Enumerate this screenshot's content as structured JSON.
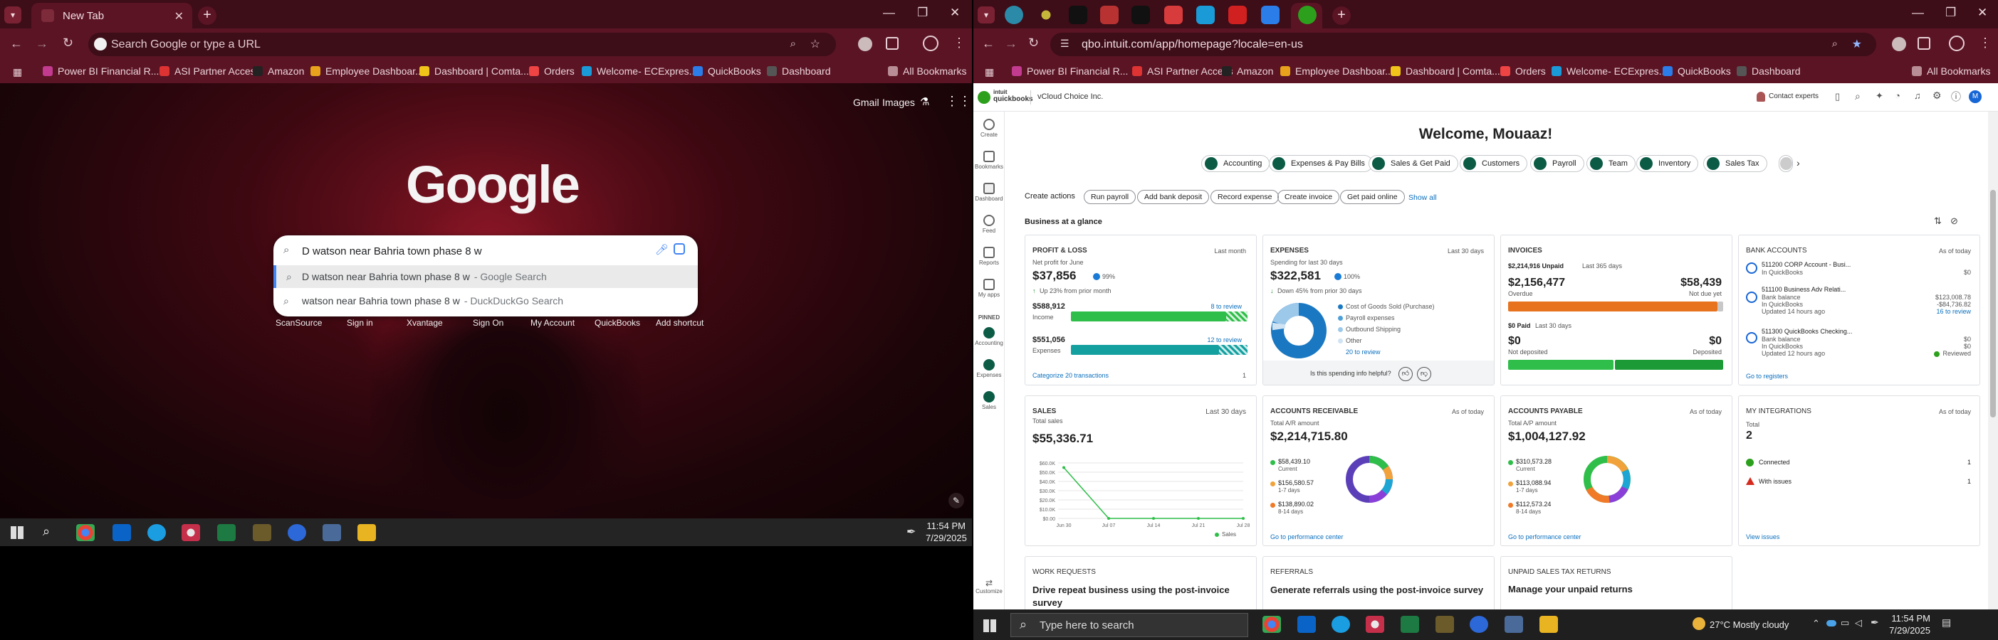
{
  "left": {
    "tab_title": "New Tab",
    "omnibox_placeholder": "Search Google or type a URL",
    "bookmarks": [
      "Power BI Financial R...",
      "ASI Partner Access",
      "Amazon",
      "Employee Dashboar...",
      "Dashboard | Comta...",
      "Orders",
      "Welcome- ECExpres...",
      "QuickBooks",
      "Dashboard"
    ],
    "all_bookmarks": "All Bookmarks",
    "google_logo": "Google",
    "top_links": {
      "gmail": "Gmail",
      "images": "Images"
    },
    "search_query": "D watson near Bahria town phase 8 w",
    "suggestions": [
      {
        "text": "D watson near Bahria town phase 8 w",
        "source": "- Google Search"
      },
      {
        "text": "watson near Bahria town phase 8 w",
        "source": "- DuckDuckGo Search"
      }
    ],
    "shortcuts": [
      "ScanSource",
      "Sign in",
      "Xvantage",
      "Sign On",
      "My Account",
      "QuickBooks",
      "Add shortcut"
    ],
    "clock": {
      "time": "11:54 PM",
      "date": "7/29/2025"
    }
  },
  "right": {
    "url": "qbo.intuit.com/app/homepage?locale=en-us",
    "bookmarks": [
      "Power BI Financial R...",
      "ASI Partner Access",
      "Amazon",
      "Employee Dashboar...",
      "Dashboard | Comta...",
      "Orders",
      "Welcome- ECExpres...",
      "QuickBooks",
      "Dashboard"
    ],
    "all_bookmarks": "All Bookmarks",
    "qb": {
      "brand_top": "intuit",
      "brand": "quickbooks",
      "company": "vCloud Choice Inc.",
      "contact": "Contact experts",
      "welcome": "Welcome, Mouaaz!",
      "sidebar": [
        "Create",
        "Bookmarks",
        "Dashboard",
        "Feed",
        "Reports",
        "My apps",
        "PINNED",
        "Accounting",
        "Expenses",
        "Sales",
        "Customize"
      ],
      "pills": [
        "Accounting",
        "Expenses & Pay Bills",
        "Sales & Get Paid",
        "Customers",
        "Payroll",
        "Team",
        "Inventory",
        "Sales Tax"
      ],
      "create_actions_label": "Create actions",
      "create_actions": [
        "Run payroll",
        "Add bank deposit",
        "Record expense",
        "Create invoice",
        "Get paid online"
      ],
      "show_all": "Show all",
      "glance": "Business at a glance",
      "pl": {
        "title": "PROFIT & LOSS",
        "period": "Last month",
        "sub": "Net profit for June",
        "value": "$37,856",
        "pct": "99%",
        "change": "Up 23% from prior month",
        "income": "$588,912",
        "income_label": "Income",
        "income_review": "8 to review",
        "expenses": "$551,056",
        "expenses_label": "Expenses",
        "expenses_review": "12 to review",
        "categorize": "Categorize 20 transactions",
        "page": "1"
      },
      "exp": {
        "title": "EXPENSES",
        "period": "Last 30 days",
        "sub": "Spending for last 30 days",
        "value": "$322,581",
        "pct": "100%",
        "change": "Down 45% from prior 30 days",
        "legend": [
          "Cost of Goods Sold (Purchase)",
          "Payroll expenses",
          "Outbound Shipping",
          "Other"
        ],
        "review": "20 to review",
        "helpful": "Is this spending info helpful?"
      },
      "inv": {
        "title": "INVOICES",
        "unpaid": "$2,214,916 Unpaid",
        "unpaid_period": "Last 365 days",
        "overdue_value": "$2,156,477",
        "overdue_label": "Overdue",
        "notdue_value": "$58,439",
        "notdue_label": "Not due yet",
        "paid": "$0 Paid",
        "paid_period": "Last 30 days",
        "notdep_value": "$0",
        "notdep_label": "Not deposited",
        "dep_value": "$0",
        "dep_label": "Deposited"
      },
      "bank": {
        "title": "BANK ACCOUNTS",
        "asof": "As of today",
        "accounts": [
          {
            "name": "511200 CORP Account - Busi...",
            "l1": "In QuickBooks",
            "v1": "$0",
            "l2": "",
            "v2": "",
            "l3": "",
            "v3": ""
          },
          {
            "name": "511100 Business Adv Relati...",
            "l1": "Bank balance",
            "v1": "$123,008.78",
            "l2": "In QuickBooks",
            "v2": "-$84,736.82",
            "l3": "Updated 14 hours ago",
            "v3": "16 to review"
          },
          {
            "name": "511300 QuickBooks Checking...",
            "l1": "Bank balance",
            "v1": "$0",
            "l2": "In QuickBooks",
            "v2": "$0",
            "l3": "Updated 12 hours ago",
            "v3": "Reviewed"
          }
        ],
        "go": "Go to registers"
      },
      "sales": {
        "title": "SALES",
        "period": "Last 30 days",
        "sub": "Total sales",
        "value": "$55,336.71",
        "yticks": [
          "$60.0K",
          "$50.0K",
          "$40.0K",
          "$30.0K",
          "$20.0K",
          "$10.0K",
          "$0.00"
        ],
        "xticks": [
          "Jun 30",
          "Jul 07",
          "Jul 14",
          "Jul 21",
          "Jul 28"
        ],
        "legend": "Sales"
      },
      "ar": {
        "title": "ACCOUNTS RECEIVABLE",
        "asof": "As of today",
        "sub": "Total A/R amount",
        "value": "$2,214,715.80",
        "items": [
          {
            "v": "$58,439.10",
            "l": "Current"
          },
          {
            "v": "$156,580.57",
            "l": "1-7 days"
          },
          {
            "v": "$138,890.02",
            "l": "8-14 days"
          }
        ],
        "go": "Go to performance center"
      },
      "ap": {
        "title": "ACCOUNTS PAYABLE",
        "asof": "As of today",
        "sub": "Total A/P amount",
        "value": "$1,004,127.92",
        "items": [
          {
            "v": "$310,573.28",
            "l": "Current"
          },
          {
            "v": "$113,088.94",
            "l": "1-7 days"
          },
          {
            "v": "$112,573.24",
            "l": "8-14 days"
          }
        ],
        "go": "Go to performance center"
      },
      "integ": {
        "title": "MY INTEGRATIONS",
        "asof": "As of today",
        "sub": "Total",
        "value": "2",
        "connected": "Connected",
        "connected_n": "1",
        "issues": "With issues",
        "issues_n": "1",
        "view": "View issues"
      },
      "work": {
        "title": "WORK REQUESTS",
        "body": "Drive repeat business using the post-invoice survey"
      },
      "ref": {
        "title": "REFERRALS",
        "body": "Generate referrals using the post-invoice survey"
      },
      "tax": {
        "title": "UNPAID SALES TAX RETURNS",
        "body": "Manage your unpaid returns"
      }
    },
    "taskbar": {
      "search": "Type here to search",
      "weather": "27°C  Mostly cloudy",
      "time": "11:54 PM",
      "date": "7/29/2025"
    }
  },
  "chart_data": {
    "type": "line",
    "title": "SALES",
    "x": [
      "Jun 30",
      "Jul 07",
      "Jul 14",
      "Jul 21",
      "Jul 28"
    ],
    "series": [
      {
        "name": "Sales",
        "values": [
          55000,
          0,
          0,
          0,
          0
        ]
      }
    ],
    "ylim": [
      0,
      60000
    ]
  },
  "colors": {
    "brand_green": "#2ca01c",
    "qb_dark": "#0b5b45",
    "bar_green": "#2fbe4a",
    "bar_teal": "#15a0a0",
    "bar_orange": "#e7731f",
    "chrome_dark": "#3d0d18",
    "chrome_mid": "#5a1424"
  }
}
